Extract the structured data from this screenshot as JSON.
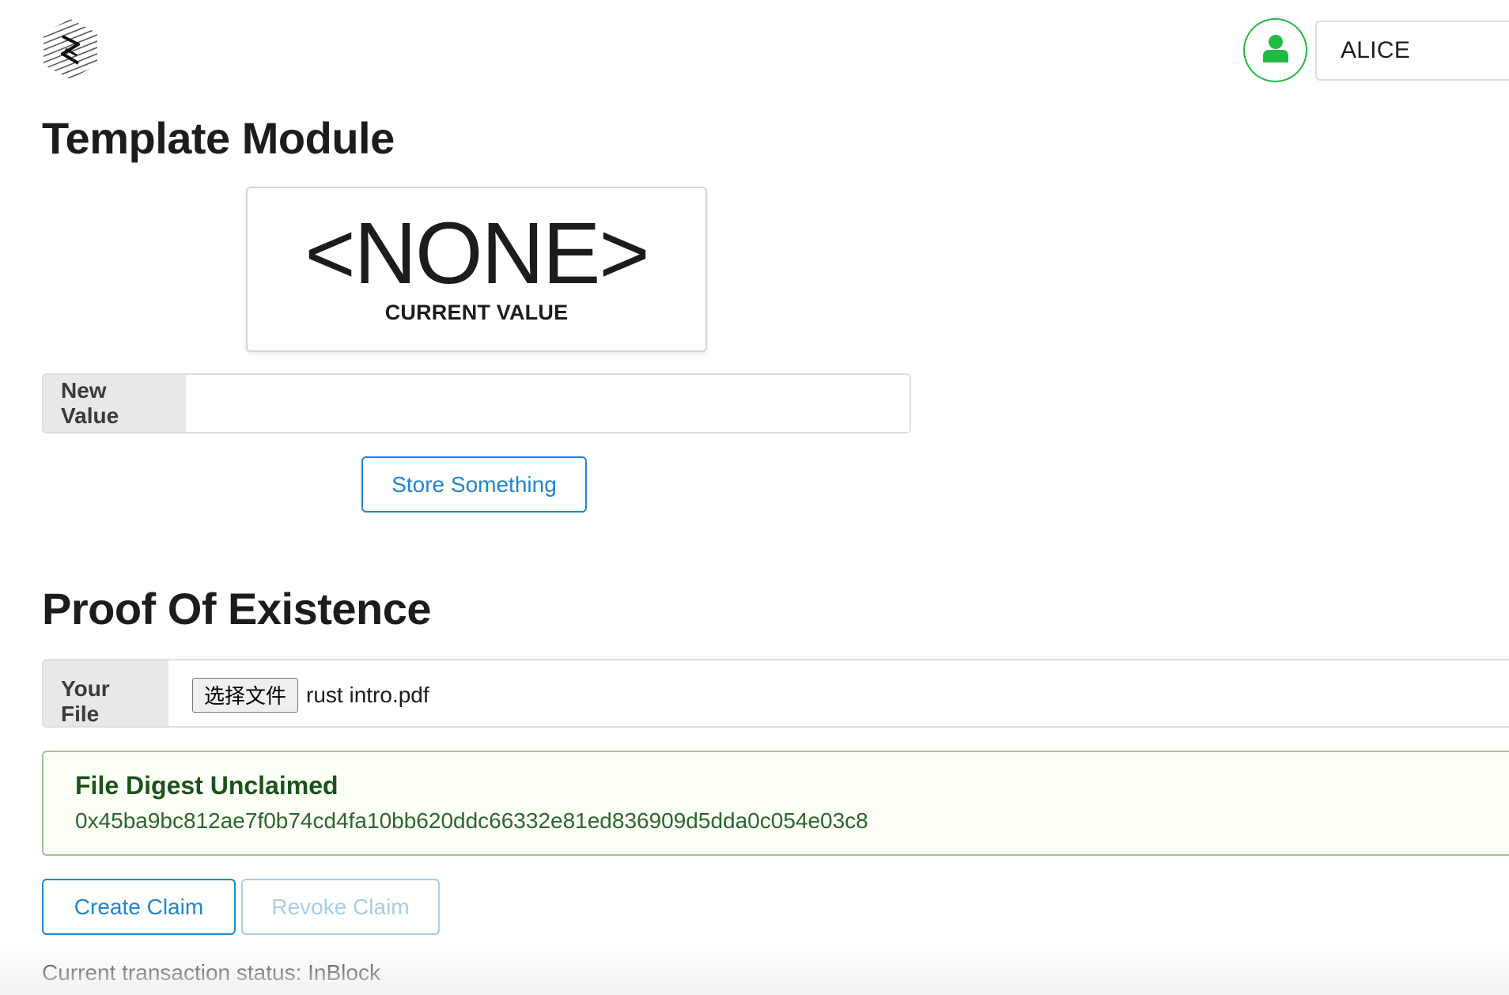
{
  "header": {
    "logo_icon": "substrate-logo-icon",
    "avatar_icon": "user-icon",
    "account_name": "ALICE"
  },
  "template_module": {
    "title": "Template Module",
    "current_value": "<NONE>",
    "current_value_label": "CURRENT VALUE",
    "new_value_label": "New Value",
    "new_value_input": "",
    "store_button": "Store Something"
  },
  "proof_of_existence": {
    "title": "Proof Of Existence",
    "file_label": "Your File",
    "choose_file_button": "选择文件",
    "file_name": "rust intro.pdf",
    "message_title": "File Digest Unclaimed",
    "digest": "0x45ba9bc812ae7f0b74cd4fa10bb620ddc66332e81ed836909d5dda0c054e03c8",
    "create_button": "Create Claim",
    "revoke_button": "Revoke Claim",
    "status": "Current transaction status: InBlock"
  },
  "colors": {
    "primary_blue": "#2185d0",
    "disabled_blue": "#a8cde9",
    "avatar_green": "#21ba45",
    "positive_bg": "#fcfff5",
    "positive_border": "#a3c293",
    "positive_title": "#1a531b",
    "positive_text": "#2c662d"
  }
}
